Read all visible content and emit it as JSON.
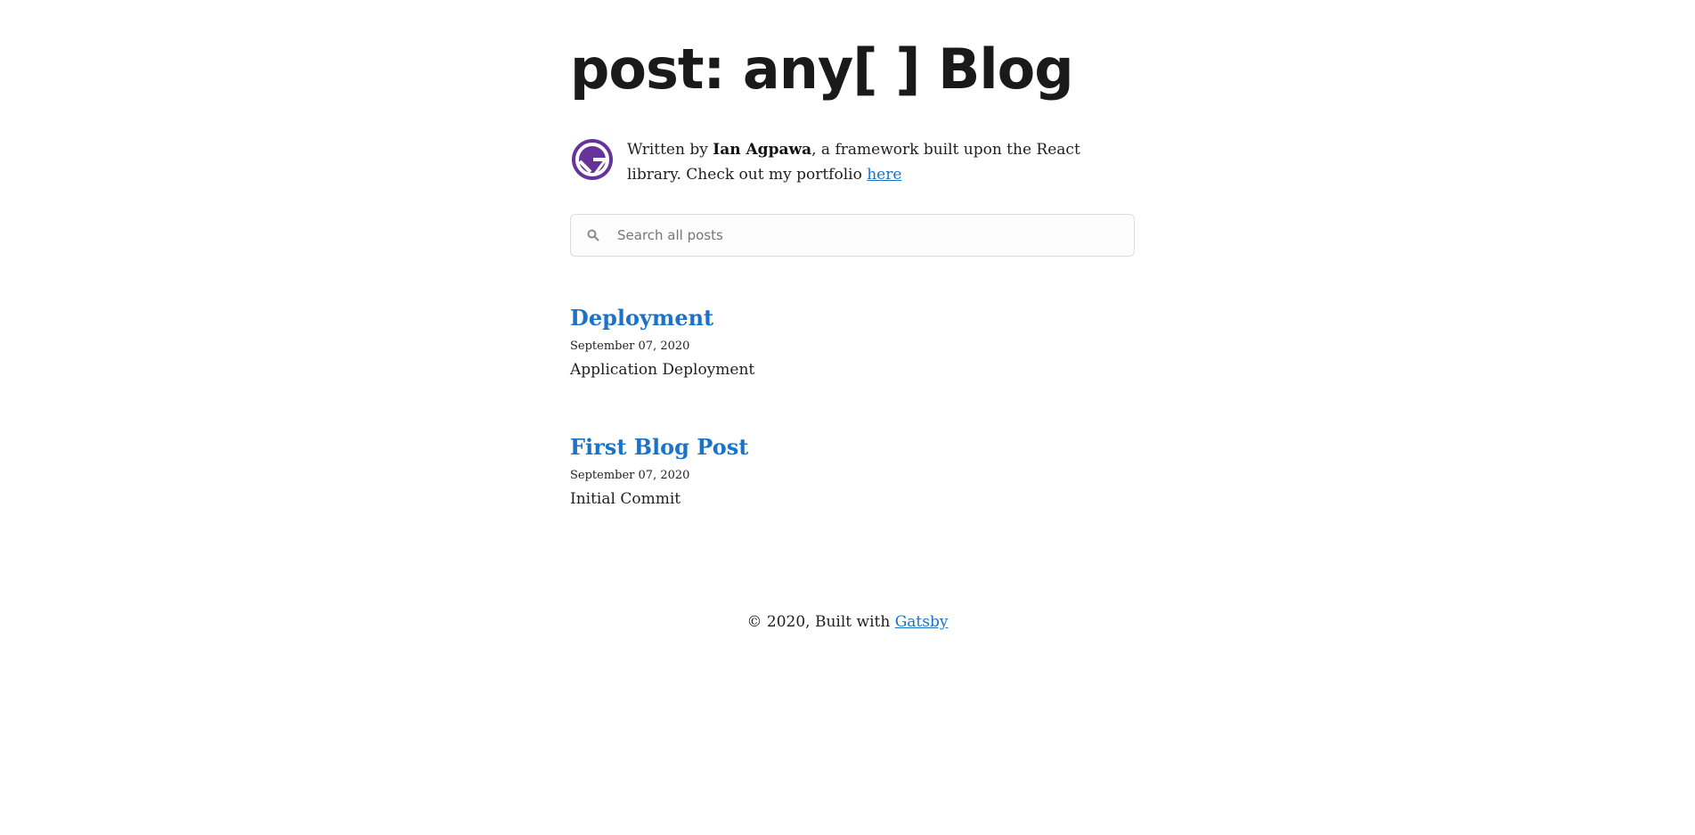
{
  "header": {
    "site_title": "post: any[ ] Blog"
  },
  "bio": {
    "prefix": "Written by ",
    "author": "Ian Agpawa",
    "middle": ", a framework built upon the React library. Check out my portfolio ",
    "portfolio_link": "here",
    "avatar_icon": "gatsby-logo-icon",
    "avatar_color": "#663399"
  },
  "search": {
    "placeholder": "Search all posts",
    "value": ""
  },
  "posts": [
    {
      "title": "Deployment",
      "date": "September 07, 2020",
      "description": "Application Deployment"
    },
    {
      "title": "First Blog Post",
      "date": "September 07, 2020",
      "description": "Initial Commit"
    }
  ],
  "footer": {
    "text": "© 2020, Built with ",
    "link": "Gatsby"
  },
  "colors": {
    "link": "#1a73c8",
    "text": "#1f1f1f"
  }
}
